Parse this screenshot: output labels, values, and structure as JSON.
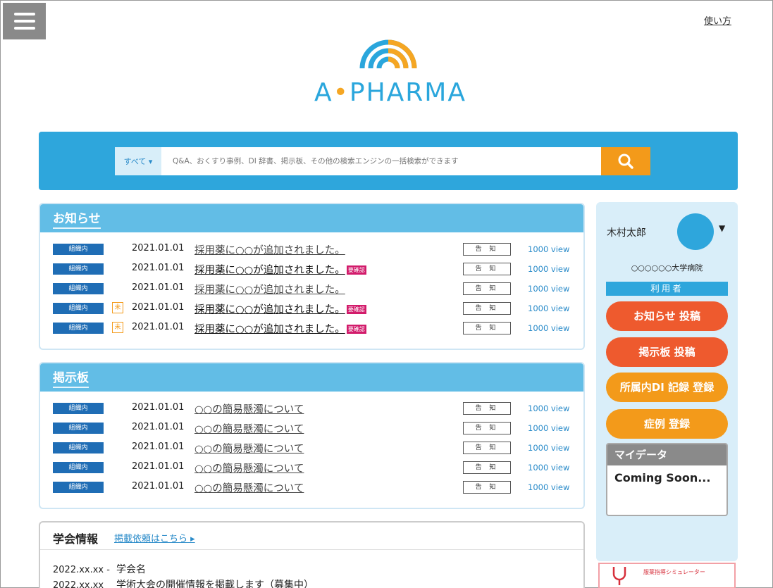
{
  "header": {
    "help_label": "使い方",
    "logo": {
      "text_a": "A",
      "text_rest": "PHARMA"
    }
  },
  "search": {
    "scope_label": "すべて ▾",
    "placeholder": "Q&A、おくすり事例、DI 辞書、掲示板、その他の検索エンジンの一括検索ができます"
  },
  "notices": {
    "title": "お知らせ",
    "rows": [
      {
        "badge": "組織内",
        "new_mark": "",
        "date": "2021.01.01",
        "title": "採用薬に○○が追加されました。",
        "tag": "",
        "type": "告 知",
        "views": "1000 view"
      },
      {
        "badge": "組織内",
        "new_mark": "",
        "date": "2021.01.01",
        "title": "採用薬に○○が追加されました。",
        "tag": "要確認",
        "type": "告 知",
        "views": "1000 view"
      },
      {
        "badge": "組織内",
        "new_mark": "",
        "date": "2021.01.01",
        "title": "採用薬に○○が追加されました。",
        "tag": "",
        "type": "告 知",
        "views": "1000 view"
      },
      {
        "badge": "組織内",
        "new_mark": "未",
        "date": "2021.01.01",
        "title": "採用薬に○○が追加されました。",
        "tag": "要確認",
        "type": "告 知",
        "views": "1000 view"
      },
      {
        "badge": "組織内",
        "new_mark": "未",
        "date": "2021.01.01",
        "title": "採用薬に○○が追加されました。",
        "tag": "要確認",
        "type": "告 知",
        "views": "1000 view"
      }
    ]
  },
  "board": {
    "title": "掲示板",
    "rows": [
      {
        "badge": "組織内",
        "date": "2021.01.01",
        "title": "○○の簡易懸濁について",
        "type": "告 知",
        "views": "1000 view"
      },
      {
        "badge": "組織内",
        "date": "2021.01.01",
        "title": "○○の簡易懸濁について",
        "type": "告 知",
        "views": "1000 view"
      },
      {
        "badge": "組織内",
        "date": "2021.01.01",
        "title": "○○の簡易懸濁について",
        "type": "告 知",
        "views": "1000 view"
      },
      {
        "badge": "組織内",
        "date": "2021.01.01",
        "title": "○○の簡易懸濁について",
        "type": "告 知",
        "views": "1000 view"
      },
      {
        "badge": "組織内",
        "date": "2021.01.01",
        "title": "○○の簡易懸濁について",
        "type": "告 知",
        "views": "1000 view"
      }
    ]
  },
  "conference": {
    "title": "学会情報",
    "link": "掲載依頼はこちら",
    "rows": [
      {
        "date": "2022.xx.xx -",
        "text": "学会名"
      },
      {
        "date": "2022.xx.xx",
        "text": "学術大会の開催情報を掲載します（募集中）"
      }
    ]
  },
  "sidebar": {
    "user_name": "木村太郎",
    "org": "○○○○○○大学病院",
    "role": "利用者",
    "actions": [
      {
        "label": "お知らせ 投稿",
        "color": "#ee5a2e"
      },
      {
        "label": "掲示板 投稿",
        "color": "#ee5a2e"
      },
      {
        "label": "所属内DI 記録 登録",
        "color": "#f39a1a"
      },
      {
        "label": "症例 登録",
        "color": "#f39a1a"
      }
    ],
    "mydata": {
      "title": "マイデータ",
      "body": "Coming Soon..."
    },
    "banner_text": "服薬指導シミュレーター"
  },
  "colors": {
    "brand_blue": "#2ea6dc",
    "accent_orange": "#f39a1a",
    "badge_blue": "#1f6db5",
    "tag_pink": "#d21b6b"
  }
}
